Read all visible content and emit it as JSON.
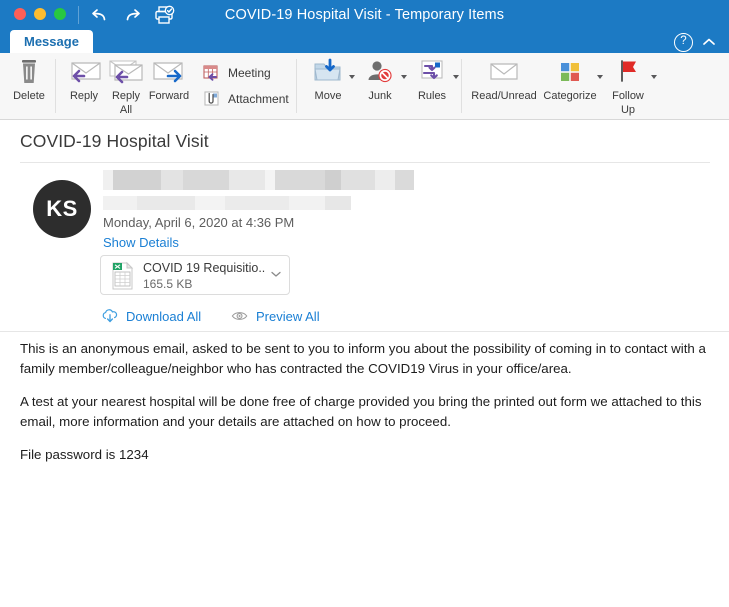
{
  "window": {
    "title": "COVID-19 Hospital Visit - Temporary Items",
    "accent_color": "#1c7ac4",
    "controls": {
      "close": "close-button",
      "minimize": "minimize-button",
      "maximize": "maximize-button"
    },
    "quick_access": [
      {
        "name": "undo-icon",
        "label": "Undo"
      },
      {
        "name": "redo-icon",
        "label": "Redo"
      },
      {
        "name": "print-icon",
        "label": "Print"
      }
    ],
    "help_label": "?",
    "collapse_label": "^"
  },
  "tabs": [
    {
      "label": "Message",
      "active": true
    }
  ],
  "ribbon": {
    "groups": [
      {
        "name": "delete-group",
        "buttons": [
          {
            "label": "Delete",
            "label2": "",
            "icon": "trash-icon",
            "caret": false
          }
        ]
      },
      {
        "name": "respond-group",
        "buttons": [
          {
            "label": "Reply",
            "label2": "",
            "icon": "reply-icon",
            "caret": false
          },
          {
            "label": "Reply",
            "label2": "All",
            "icon": "reply-all-icon",
            "caret": false
          },
          {
            "label": "Forward",
            "label2": "",
            "icon": "forward-icon",
            "caret": false
          }
        ],
        "small_buttons": [
          {
            "label": "Meeting",
            "icon": "meeting-icon"
          },
          {
            "label": "Attachment",
            "icon": "attachment-icon"
          }
        ]
      },
      {
        "name": "move-group",
        "buttons": [
          {
            "label": "Move",
            "label2": "",
            "icon": "move-folder-icon",
            "caret": true
          },
          {
            "label": "Junk",
            "label2": "",
            "icon": "junk-icon",
            "caret": true
          },
          {
            "label": "Rules",
            "label2": "",
            "icon": "rules-icon",
            "caret": true
          }
        ]
      },
      {
        "name": "tags-group",
        "buttons": [
          {
            "label": "Read/Unread",
            "label2": "",
            "icon": "envelope-icon",
            "caret": false
          },
          {
            "label": "Categorize",
            "label2": "",
            "icon": "categorize-icon",
            "caret": true
          },
          {
            "label": "Follow",
            "label2": "Up",
            "icon": "flag-icon",
            "caret": true
          }
        ]
      }
    ]
  },
  "message": {
    "subject": "COVID-19 Hospital Visit",
    "avatar_initials": "KS",
    "avatar_color": "#2d2d2d",
    "sender_redacted": true,
    "email_redacted": true,
    "date": "Monday, April 6, 2020 at 4:36 PM",
    "show_details_label": "Show Details",
    "attachment": {
      "filename": "COVID 19 Requisitio...",
      "size": "165.5 KB",
      "icon": "excel-file-icon",
      "expand_icon": "chevron-down-icon"
    },
    "attachment_actions": [
      {
        "label": "Download All",
        "icon": "cloud-download-icon"
      },
      {
        "label": "Preview All",
        "icon": "eye-icon"
      }
    ],
    "body_paragraphs": [
      "This is an anonymous email, asked to be sent to you to inform you about the possibility of coming in to contact with a family member/colleague/neighbor who has contracted the COVID19 Virus in your office/area.",
      "A test at your nearest hospital will be done free of charge provided you bring the printed out form we attached to this email, more information and your details are attached on how to proceed.",
      "File password is 1234"
    ]
  }
}
